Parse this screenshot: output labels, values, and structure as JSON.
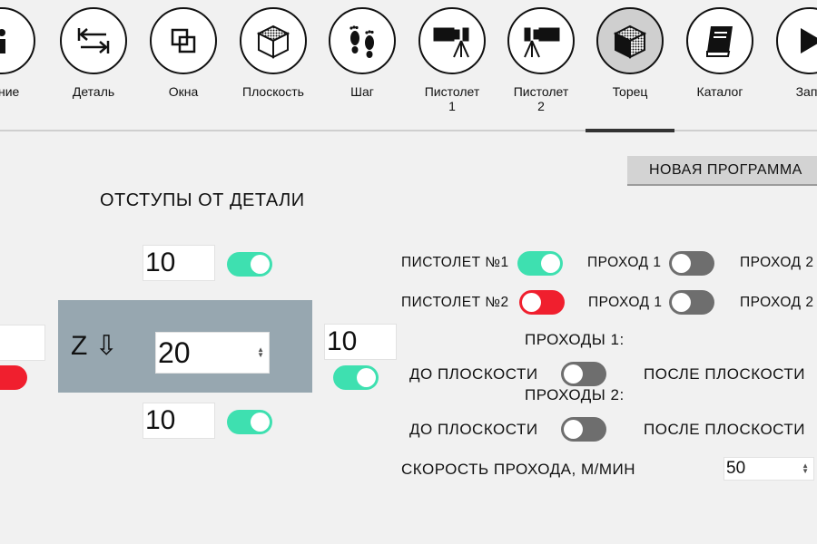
{
  "toolbar": [
    {
      "label": "ояние",
      "icon": "info-icon"
    },
    {
      "label": "Деталь",
      "icon": "arrows-to-edge-icon"
    },
    {
      "label": "Окна",
      "icon": "windows-icon"
    },
    {
      "label": "Плоскость",
      "icon": "textured-cube-icon"
    },
    {
      "label": "Шаг",
      "icon": "footsteps-icon"
    },
    {
      "label": "Пистолет\n1",
      "icon": "spray-gun-icon"
    },
    {
      "label": "Пистолет\n2",
      "icon": "spray-gun-icon"
    },
    {
      "label": "Торец",
      "icon": "end-face-cube-icon"
    },
    {
      "label": "Каталог",
      "icon": "catalog-book-icon"
    },
    {
      "label": "Запу",
      "icon": "play-icon"
    }
  ],
  "active_tab": "Торец",
  "new_program_label": "НОВАЯ ПРОГРАММА",
  "offsets": {
    "title": "ОТСТУПЫ ОТ ДЕТАЛИ",
    "top_value": "10",
    "right_value": "10",
    "bottom_value": "10",
    "left_value": "",
    "z_label": "Z ⇩",
    "z_value": "20",
    "top_toggle": "on",
    "right_toggle": "on",
    "bottom_toggle": "on",
    "left_toggle": "alert"
  },
  "guns": [
    {
      "label": "ПИСТОЛЕТ №1",
      "gun_toggle": "on",
      "pass1_label": "ПРОХОД 1",
      "pass1_toggle": "off",
      "pass2_label": "ПРОХОД 2"
    },
    {
      "label": "ПИСТОЛЕТ №2",
      "gun_toggle": "alert",
      "pass1_label": "ПРОХОД 1",
      "pass1_toggle": "off",
      "pass2_label": "ПРОХОД 2"
    }
  ],
  "passes": [
    {
      "title": "ПРОХОДЫ 1:",
      "before_label": "ДО ПЛОСКОСТИ",
      "before_toggle": "off",
      "after_label": "ПОСЛЕ ПЛОСКОСТИ"
    },
    {
      "title": "ПРОХОДЫ 2:",
      "before_label": "ДО ПЛОСКОСТИ",
      "before_toggle": "off",
      "after_label": "ПОСЛЕ ПЛОСКОСТИ"
    }
  ],
  "speed": {
    "label": "СКОРОСТЬ ПРОХОДА, М/МИН",
    "value": "50"
  },
  "colors": {
    "toggle_on": "#3ee0b0",
    "toggle_off": "#6e6e6e",
    "toggle_alert": "#f01f2e",
    "z_block": "#97a7b0"
  }
}
